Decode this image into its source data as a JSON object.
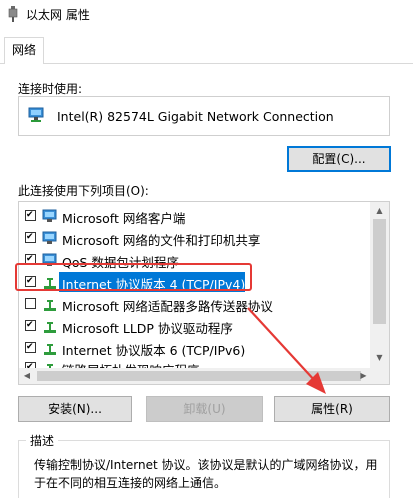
{
  "window": {
    "title": "以太网 属性"
  },
  "tabs": [
    {
      "label": "网络"
    }
  ],
  "connect_using": {
    "label": "连接时使用:",
    "adapter": "Intel(R) 82574L Gigabit Network Connection",
    "configure_button": "配置(C)..."
  },
  "items_section": {
    "label": "此连接使用下列项目(O):",
    "items": [
      {
        "label": "Microsoft 网络客户端",
        "checked": true
      },
      {
        "label": "Microsoft 网络的文件和打印机共享",
        "checked": true
      },
      {
        "label": "QoS 数据包计划程序",
        "checked": true
      },
      {
        "label": "Internet 协议版本 4 (TCP/IPv4)",
        "checked": true,
        "selected": true
      },
      {
        "label": "Microsoft 网络适配器多路传送器协议",
        "checked": false
      },
      {
        "label": "Microsoft LLDP 协议驱动程序",
        "checked": true
      },
      {
        "label": "Internet 协议版本 6 (TCP/IPv6)",
        "checked": true
      },
      {
        "label": "链路层拓扑发现响应程序",
        "checked": true
      }
    ]
  },
  "buttons": {
    "install": "安装(N)...",
    "uninstall": "卸载(U)",
    "properties": "属性(R)"
  },
  "description": {
    "label": "描述",
    "text": "传输控制协议/Internet 协议。该协议是默认的广域网络协议，用于在不同的相互连接的网络上通信。"
  },
  "colors": {
    "selection": "#0078d7",
    "annotation": "#e53935"
  }
}
